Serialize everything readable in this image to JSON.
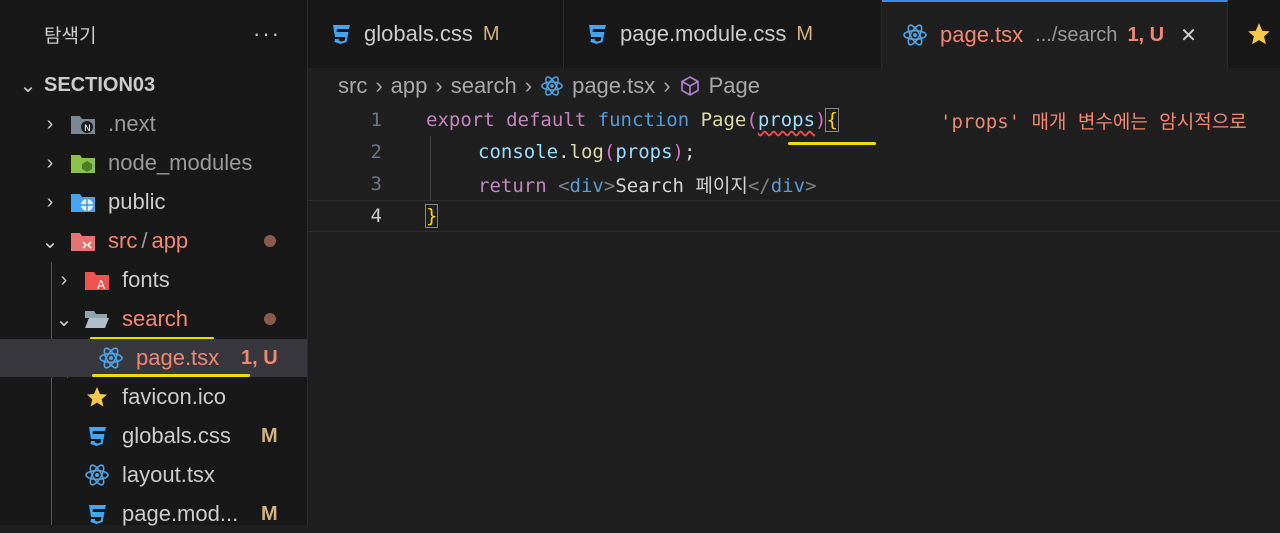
{
  "sidebar": {
    "title": "탐색기",
    "more": "···",
    "section": "SECTION03",
    "items": [
      {
        "label": ".next",
        "chevron": "›",
        "icon": "next-folder-icon"
      },
      {
        "label": "node_modules",
        "chevron": "›",
        "icon": "node-folder-icon"
      },
      {
        "label": "public",
        "chevron": "›",
        "icon": "public-folder-icon"
      },
      {
        "label": "src",
        "sep": "/",
        "label2": "app",
        "chevron": "⌄",
        "icon": "src-folder-icon"
      },
      {
        "label": "fonts",
        "chevron": "›",
        "icon": "font-folder-icon"
      },
      {
        "label": "search",
        "chevron": "⌄",
        "icon": "folder-open-icon"
      },
      {
        "label": "page.tsx",
        "badge": "1, U",
        "icon": "react-icon"
      },
      {
        "label": "favicon.ico",
        "icon": "star-icon"
      },
      {
        "label": "globals.css",
        "badge": "M",
        "icon": "css-icon"
      },
      {
        "label": "layout.tsx",
        "icon": "react-icon"
      },
      {
        "label": "page.mod...",
        "badge": "M",
        "icon": "css-icon"
      }
    ]
  },
  "tabs": [
    {
      "label": "globals.css",
      "badge": "M",
      "icon": "css-icon"
    },
    {
      "label": "page.module.css",
      "badge": "M",
      "icon": "css-icon"
    },
    {
      "label": "page.tsx",
      "path": ".../search",
      "badge": "1, U",
      "close": "✕",
      "icon": "react-icon"
    }
  ],
  "breadcrumb": [
    "src",
    "app",
    "search",
    "page.tsx",
    "Page"
  ],
  "editor": {
    "line_numbers": [
      "1",
      "2",
      "3",
      "4"
    ],
    "line1": {
      "export": "export",
      "default": "default",
      "function": "function",
      "name": "Page",
      "open": "(",
      "param": "props",
      "close": ")",
      "brace": "{"
    },
    "inline_error": "'props' 매개 변수에는 암시적으로",
    "line2": {
      "obj": "console",
      "dot": ".",
      "method": "log",
      "open": "(",
      "arg": "props",
      "close": ")",
      "semi": ";"
    },
    "line3": {
      "ret": "return",
      "lt": "<",
      "tag": "div",
      "gt": ">",
      "text": "Search 페이지",
      "lt2": "</",
      "tag2": "div",
      "gt2": ">"
    },
    "line4": {
      "brace": "}"
    }
  },
  "colors": {
    "accent": "#3c8ce7",
    "error": "#f48771",
    "modified": "#d2b27e",
    "highlight": "#f2dc00"
  }
}
